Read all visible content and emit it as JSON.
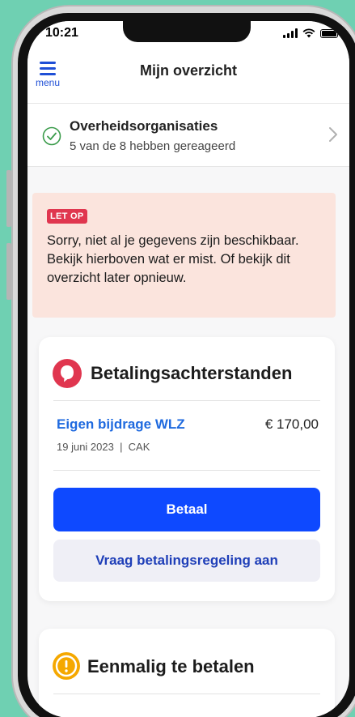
{
  "status_bar": {
    "time": "10:21"
  },
  "header": {
    "menu_label": "menu",
    "title": "Mijn overzicht"
  },
  "organisations": {
    "title": "Overheidsorganisaties",
    "subtitle": "5 van de 8 hebben gereageerd"
  },
  "alert": {
    "badge": "LET OP",
    "text": "Sorry, niet al je gegevens zijn beschikbaar. Bekijk hierboven wat er mist. Of bekijk dit overzicht later opnieuw."
  },
  "arrears_card": {
    "title": "Betalingsachterstanden",
    "item": {
      "title": "Eigen bijdrage WLZ",
      "amount": "€ 170,00",
      "meta": "19 juni 2023  |  CAK"
    },
    "pay_button": "Betaal",
    "arrangement_button": "Vraag betalingsregeling aan"
  },
  "one_off_card": {
    "title": "Eenmalig te betalen"
  },
  "colors": {
    "accent_blue": "#0e49ff",
    "link_blue": "#1f6adf",
    "alert_background": "#fbe4dd",
    "badge_red": "#e0364f",
    "warning_yellow": "#f5a800",
    "background": "#6fd0b2"
  }
}
